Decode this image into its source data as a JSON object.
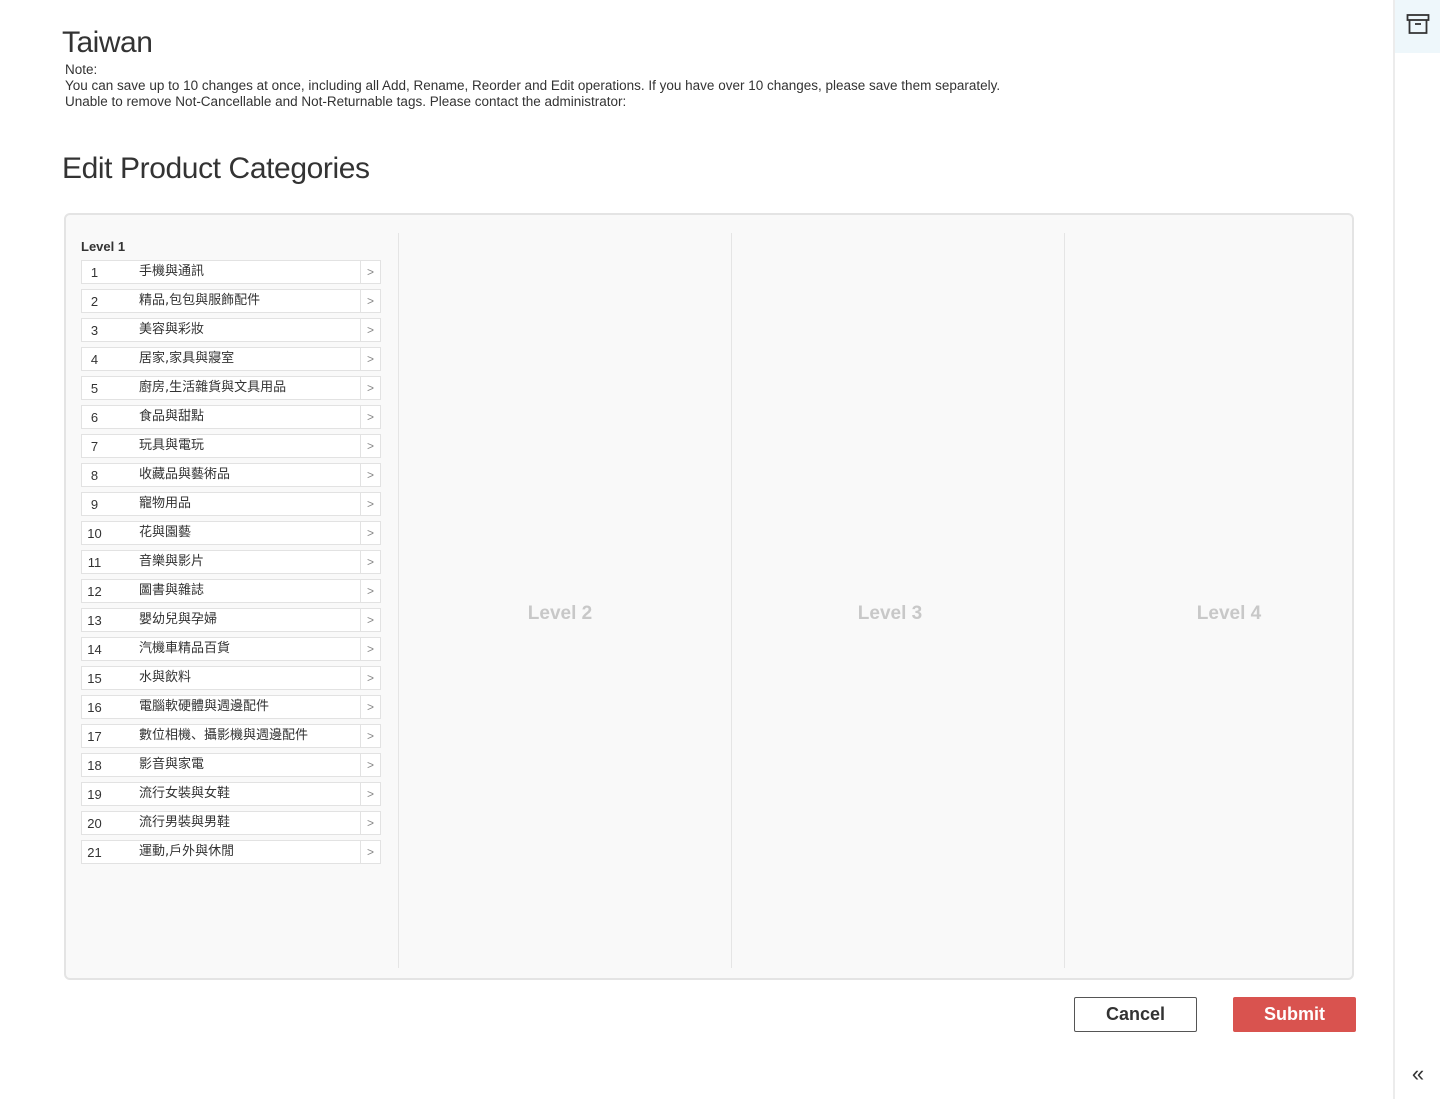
{
  "region_title": "Taiwan",
  "notes": {
    "label": "Note:",
    "line1": "You can save up to 10 changes at once, including all Add, Rename, Reorder and Edit operations. If you have over 10 changes, please save them separately.",
    "line2": "Unable to remove Not-Cancellable and Not-Returnable tags. Please contact the administrator:"
  },
  "page_heading": "Edit Product Categories",
  "levels": {
    "level1_heading": "Level 1",
    "level2_placeholder": "Level 2",
    "level3_placeholder": "Level 3",
    "level4_placeholder": "Level 4"
  },
  "categories": [
    {
      "num": "1",
      "name": "手機與通訊"
    },
    {
      "num": "2",
      "name": "精品,包包與服飾配件"
    },
    {
      "num": "3",
      "name": "美容與彩妝"
    },
    {
      "num": "4",
      "name": "居家,家具與寢室"
    },
    {
      "num": "5",
      "name": "廚房,生活雜貨與文具用品"
    },
    {
      "num": "6",
      "name": "食品與甜點"
    },
    {
      "num": "7",
      "name": "玩具與電玩"
    },
    {
      "num": "8",
      "name": "收藏品與藝術品"
    },
    {
      "num": "9",
      "name": "寵物用品"
    },
    {
      "num": "10",
      "name": "花與園藝"
    },
    {
      "num": "11",
      "name": "音樂與影片"
    },
    {
      "num": "12",
      "name": "圖書與雜誌"
    },
    {
      "num": "13",
      "name": "嬰幼兒與孕婦"
    },
    {
      "num": "14",
      "name": "汽機車精品百貨"
    },
    {
      "num": "15",
      "name": "水與飲料"
    },
    {
      "num": "16",
      "name": "電腦軟硬體與週邊配件"
    },
    {
      "num": "17",
      "name": "數位相機、攝影機與週邊配件"
    },
    {
      "num": "18",
      "name": "影音與家電"
    },
    {
      "num": "19",
      "name": "流行女裝與女鞋"
    },
    {
      "num": "20",
      "name": "流行男裝與男鞋"
    },
    {
      "num": "21",
      "name": "運動,戶外與休閒"
    }
  ],
  "buttons": {
    "cancel": "Cancel",
    "submit": "Submit"
  },
  "icons": {
    "arrow": ">",
    "collapse": "«",
    "archive": "archive-box-icon"
  },
  "colors": {
    "submit": "#d9534f",
    "rail_highlight": "#eef7fb"
  }
}
